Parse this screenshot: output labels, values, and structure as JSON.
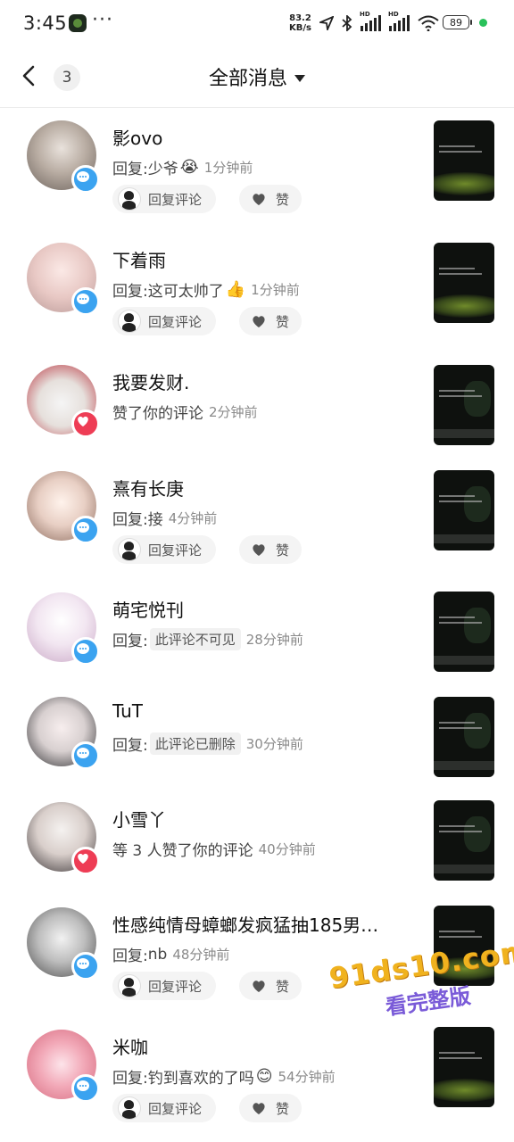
{
  "status_bar": {
    "time": "3:45",
    "more": "···",
    "net_speed_value": "83.2",
    "net_speed_unit": "KB/s",
    "signal_label_1": "HD",
    "signal_label_2": "HD",
    "battery": "89"
  },
  "header": {
    "back_icon": "chevron-left-icon",
    "unread_count": "3",
    "title": "全部消息",
    "dropdown_icon": "caret-down-icon"
  },
  "actions": {
    "reply_label": "回复评论",
    "like_label": "赞"
  },
  "messages": [
    {
      "name": "影ovo",
      "prefix": "回复: ",
      "text": "少爷",
      "emoji": "😭",
      "time": "1分钟前",
      "badge": "comment",
      "has_actions": true
    },
    {
      "name": "下着雨",
      "prefix": "回复: ",
      "text": "这可太帅了",
      "emoji": "👍",
      "time": "1分钟前",
      "badge": "comment",
      "has_actions": true
    },
    {
      "name": "我要发财.",
      "prefix": "",
      "text": "赞了你的评论",
      "time": "2分钟前",
      "badge": "like",
      "has_actions": false
    },
    {
      "name": "熹有长庚",
      "prefix": "回复: ",
      "text": "接",
      "time": "4分钟前",
      "badge": "comment",
      "has_actions": true
    },
    {
      "name": "萌宅悦刊",
      "prefix": "回复: ",
      "chip": "此评论不可见",
      "time": "28分钟前",
      "badge": "comment",
      "has_actions": false
    },
    {
      "name": "TuT",
      "prefix": "回复: ",
      "chip": "此评论已删除",
      "time": "30分钟前",
      "badge": "comment",
      "has_actions": false
    },
    {
      "name": "小雪丫",
      "prefix": "",
      "text": "等 3 人赞了你的评论",
      "time": "40分钟前",
      "badge": "like",
      "has_actions": false
    },
    {
      "name": "性感纯情母蟑螂发疯猛抽185男…",
      "prefix": "回复: ",
      "text": "nb",
      "time": "48分钟前",
      "badge": "comment",
      "has_actions": true
    },
    {
      "name": "米咖",
      "prefix": "回复: ",
      "text": "钓到喜欢的了吗",
      "emoji": "😊",
      "time": "54分钟前",
      "badge": "comment",
      "has_actions": true
    }
  ],
  "watermark": {
    "line1": "91ds10.com",
    "line2": "看完整版"
  },
  "colors": {
    "comment_badge": "#3ba3f0",
    "like_badge": "#ee3d55",
    "online_dot": "#29c15a",
    "watermark_primary": "#f0b21e",
    "watermark_secondary": "#7a5bd8"
  }
}
